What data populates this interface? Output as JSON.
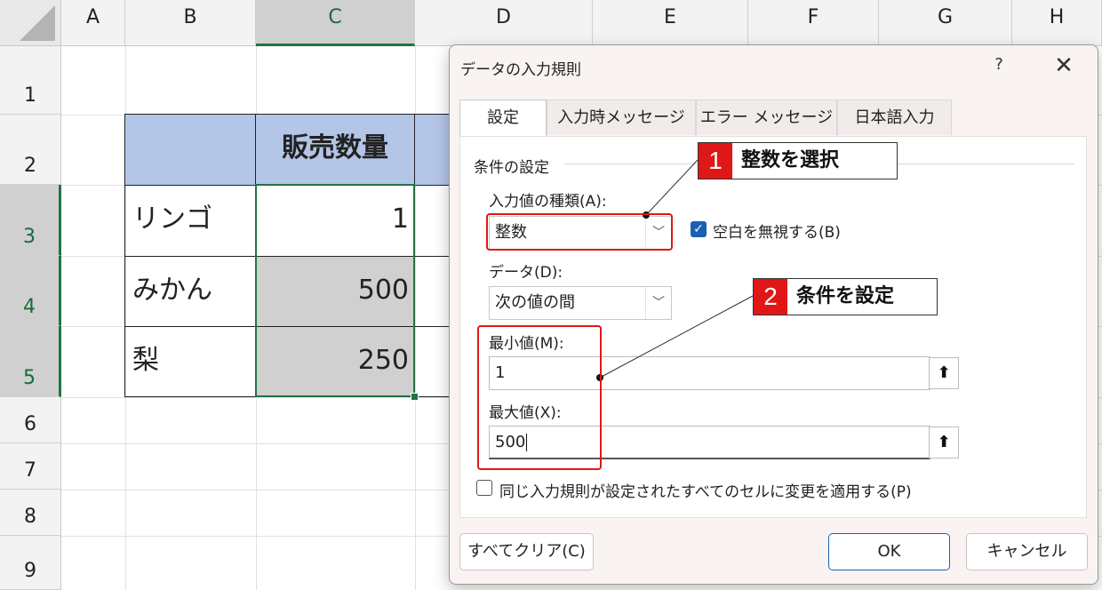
{
  "spreadsheet": {
    "columns": [
      "A",
      "B",
      "C",
      "D",
      "E",
      "F",
      "G",
      "H"
    ],
    "rows": [
      "1",
      "2",
      "3",
      "4",
      "5",
      "6",
      "7",
      "8",
      "9"
    ],
    "table": {
      "header": "販売数量",
      "labels": [
        "リンゴ",
        "みかん",
        "梨"
      ],
      "values": [
        "1",
        "500",
        "250"
      ]
    }
  },
  "dialog": {
    "title": "データの入力規則",
    "help": "?",
    "close": "✕",
    "tabs": [
      "設定",
      "入力時メッセージ",
      "エラー メッセージ",
      "日本語入力"
    ],
    "group_label": "条件の設定",
    "allow_label": "入力値の種類(A):",
    "allow_value": "整数",
    "ignore_blank_label": "空白を無視する(B)",
    "data_label": "データ(D):",
    "data_value": "次の値の間",
    "min_label": "最小値(M):",
    "min_value": "1",
    "max_label": "最大値(X):",
    "max_value": "500",
    "apply_all_label": "同じ入力規則が設定されたすべてのセルに変更を適用する(P)",
    "clear_all_label": "すべてクリア(C)",
    "ok_label": "OK",
    "cancel_label": "キャンセル"
  },
  "annotations": [
    {
      "num": "1",
      "text": "整数を選択"
    },
    {
      "num": "2",
      "text": "条件を設定"
    }
  ],
  "colors": {
    "accent_green": "#217346",
    "header_blue": "#b4c6e7",
    "highlight_red": "#e01717",
    "checkbox_blue": "#1a5fb4"
  }
}
